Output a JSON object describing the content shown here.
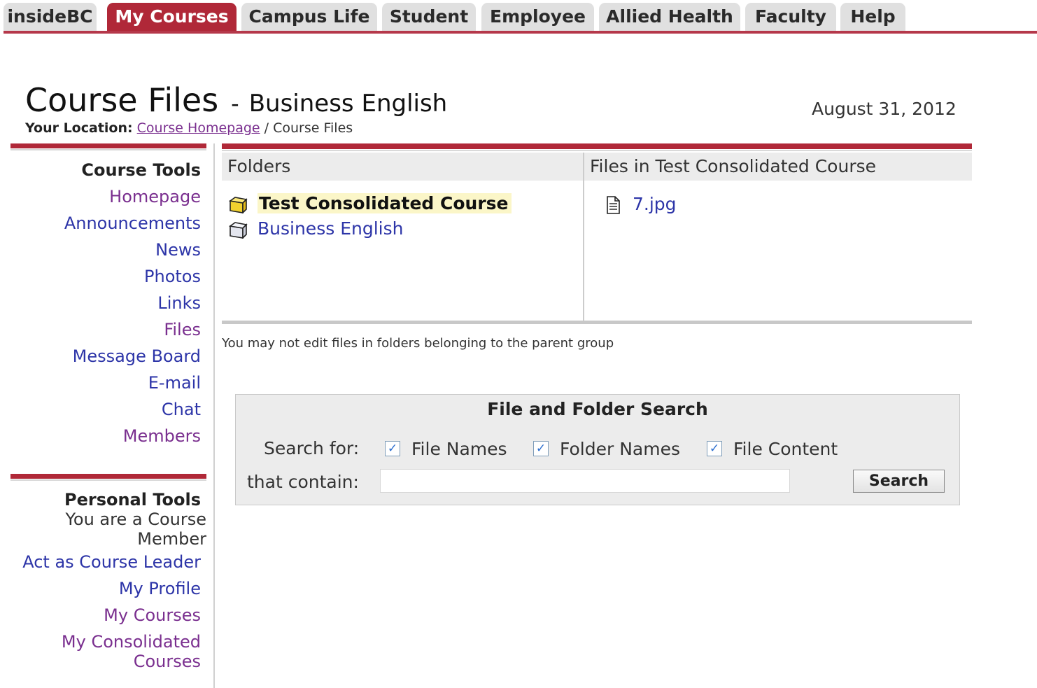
{
  "nav": {
    "tabs": [
      {
        "label": "insideBC"
      },
      {
        "label": "My Courses"
      },
      {
        "label": "Campus Life"
      },
      {
        "label": "Student"
      },
      {
        "label": "Employee"
      },
      {
        "label": "Allied Health"
      },
      {
        "label": "Faculty"
      },
      {
        "label": "Help"
      }
    ],
    "active_tab": "My Courses"
  },
  "header": {
    "title": "Course Files",
    "separator": "-",
    "course_name": "Business English",
    "date": "August 31, 2012",
    "location_label": "Your Location:",
    "breadcrumb_link": "Course Homepage",
    "breadcrumb_separator": "/",
    "breadcrumb_current": "Course Files"
  },
  "sidebar": {
    "course_tools": {
      "heading": "Course Tools",
      "items": [
        {
          "label": "Homepage"
        },
        {
          "label": "Announcements"
        },
        {
          "label": "News"
        },
        {
          "label": "Photos"
        },
        {
          "label": "Links"
        },
        {
          "label": "Files"
        },
        {
          "label": "Message Board"
        },
        {
          "label": "E-mail"
        },
        {
          "label": "Chat"
        },
        {
          "label": "Members"
        }
      ]
    },
    "personal_tools": {
      "heading": "Personal Tools",
      "role_note": "You are a Course Member",
      "items": [
        {
          "label": "Act as Course Leader"
        },
        {
          "label": "My Profile"
        },
        {
          "label": "My Courses"
        },
        {
          "label": "My Consolidated Courses"
        }
      ]
    }
  },
  "folders_panel": {
    "heading": "Folders",
    "folders": [
      {
        "name": "Test Consolidated Course",
        "icon": "folder-open-icon"
      },
      {
        "name": "Business English",
        "icon": "folder-closed-icon"
      }
    ],
    "selected_folder": "Test Consolidated Course"
  },
  "files_panel": {
    "heading": "Files in Test Consolidated Course",
    "files": [
      {
        "name": "7.jpg",
        "icon": "document-icon"
      }
    ]
  },
  "notice": "You may not edit files in folders belonging to the parent group",
  "search": {
    "title": "File and Folder Search",
    "search_for_label": "Search for:",
    "options": [
      {
        "label": "File Names",
        "checked": true
      },
      {
        "label": "Folder Names",
        "checked": true
      },
      {
        "label": "File Content",
        "checked": true
      }
    ],
    "contain_label": "that contain:",
    "query_value": "",
    "button_label": "Search"
  },
  "colors": {
    "brand_red": "#b02838",
    "link_blue": "#2d35a8",
    "visited_purple": "#7a2f8f",
    "highlight": "#fbf6c8"
  }
}
